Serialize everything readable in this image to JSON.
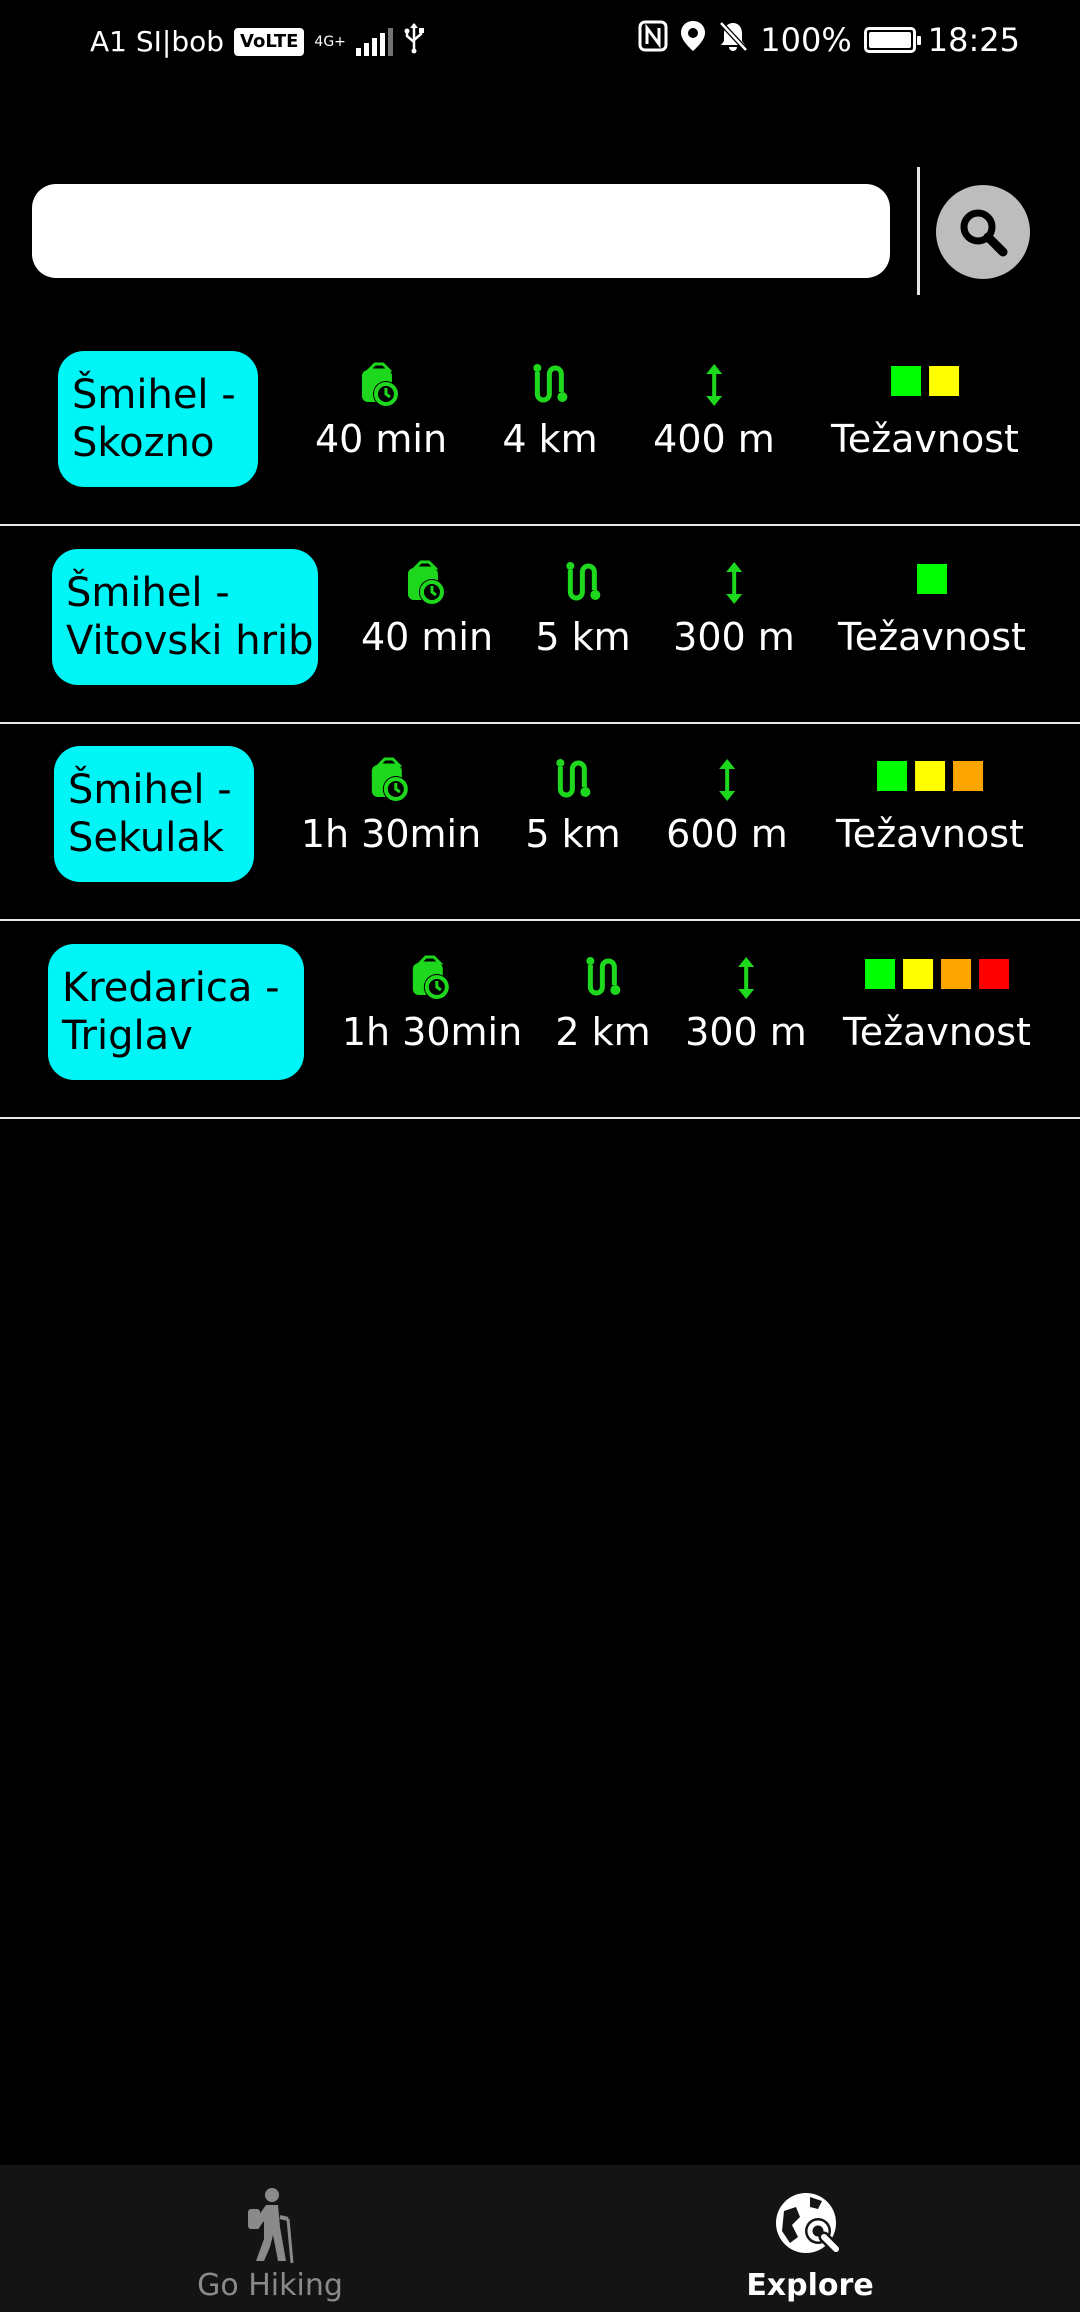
{
  "status_bar": {
    "carrier": "A1 SI|bob",
    "volte": "VoLTE",
    "network": "4G+",
    "battery": "100%",
    "time": "18:25"
  },
  "search": {
    "value": "",
    "placeholder": ""
  },
  "colors": {
    "accent_cyan": "#00F5F7",
    "icon_green": "#1ED81E",
    "diff_green": "#00FF00",
    "diff_yellow": "#FFFF00",
    "diff_orange": "#FFA500",
    "diff_red": "#FF0000"
  },
  "difficulty_label": "Težavnost",
  "trails": [
    {
      "name": "Šmihel -\nSkozno",
      "time": "40 min",
      "distance": "4 km",
      "elevation": "400 m",
      "difficulty": 2
    },
    {
      "name": "Šmihel -\nVitovski hrib",
      "time": "40 min",
      "distance": "5 km",
      "elevation": "300 m",
      "difficulty": 1
    },
    {
      "name": "Šmihel -\nSekulak",
      "time": "1h 30min",
      "distance": "5 km",
      "elevation": "600 m",
      "difficulty": 3
    },
    {
      "name": "Kredarica -\nTriglav",
      "time": "1h 30min",
      "distance": "2 km",
      "elevation": "300 m",
      "difficulty": 4
    }
  ],
  "bottom_nav": {
    "go_hiking": "Go Hiking",
    "explore": "Explore"
  }
}
